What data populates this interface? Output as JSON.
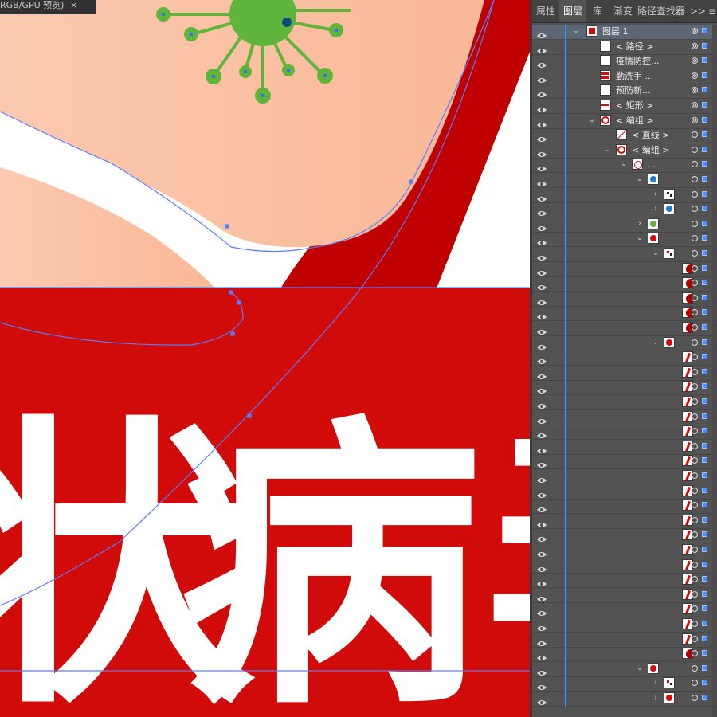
{
  "document": {
    "tab_title": "RGB/GPU 预览)",
    "close_glyph": "×"
  },
  "artwork": {
    "headline_chars": [
      "状",
      "病",
      "毒"
    ],
    "colors": {
      "banner_red": "#d10a0a",
      "ring_dark_red": "#c00000",
      "skin": "#fcc4a6",
      "virus_green": "#5fb43c",
      "white": "#ffffff",
      "path_outline": "#5b7cff"
    }
  },
  "panel": {
    "tabs": [
      "属性",
      "图层",
      "库",
      "渐变",
      "路径查找器"
    ],
    "active_tab": "图层",
    "overflow_glyph": ">>",
    "menu_glyph": "≡",
    "layers": [
      {
        "indent": 0,
        "twisty": "open",
        "thumb": "poster",
        "label": "图层 1",
        "selected": true,
        "target": "dbl"
      },
      {
        "indent": 1,
        "twisty": "none",
        "thumb": "white",
        "label": "< 路径 >",
        "target": "dbl"
      },
      {
        "indent": 1,
        "twisty": "none",
        "thumb": "white",
        "label": "疫情防控...",
        "target": "dbl"
      },
      {
        "indent": 1,
        "twisty": "none",
        "thumb": "redtext",
        "label": "勤洗手 ...",
        "target": "dbl"
      },
      {
        "indent": 1,
        "twisty": "none",
        "thumb": "white",
        "label": "预防新...",
        "target": "dbl"
      },
      {
        "indent": 1,
        "twisty": "none",
        "thumb": "redbar",
        "label": "< 矩形 >",
        "target": "dbl"
      },
      {
        "indent": 1,
        "twisty": "open",
        "thumb": "redcirc",
        "label": "< 编组 >",
        "target": "dbl"
      },
      {
        "indent": 2,
        "twisty": "none",
        "thumb": "line",
        "label": "< 直线 >",
        "target": "one"
      },
      {
        "indent": 2,
        "twisty": "open",
        "thumb": "redcirc",
        "label": "< 编组 >",
        "target": "one"
      },
      {
        "indent": 3,
        "twisty": "open",
        "thumb": "group",
        "label": "...",
        "target": "one"
      },
      {
        "indent": 4,
        "twisty": "open",
        "thumb": "bluevirus",
        "label": "",
        "target": "one"
      },
      {
        "indent": 5,
        "twisty": "closed",
        "thumb": "dots",
        "label": "",
        "target": "one"
      },
      {
        "indent": 5,
        "twisty": "closed",
        "thumb": "bluevirus",
        "label": "",
        "target": "one"
      },
      {
        "indent": 4,
        "twisty": "closed",
        "thumb": "greenvirus",
        "label": "",
        "target": "one"
      },
      {
        "indent": 4,
        "twisty": "open",
        "thumb": "redvirus",
        "label": "",
        "target": "one"
      },
      {
        "indent": 5,
        "twisty": "open",
        "thumb": "reddots",
        "label": "",
        "target": "one"
      },
      {
        "indent": 6,
        "twisty": "none",
        "thumb": "halfcirc",
        "label": "",
        "target": "one"
      },
      {
        "indent": 6,
        "twisty": "none",
        "thumb": "halfcirc",
        "label": "",
        "target": "one"
      },
      {
        "indent": 6,
        "twisty": "none",
        "thumb": "halfcirc",
        "label": "",
        "target": "one"
      },
      {
        "indent": 6,
        "twisty": "none",
        "thumb": "halfcirc",
        "label": "",
        "target": "one"
      },
      {
        "indent": 6,
        "twisty": "none",
        "thumb": "halfcirc",
        "label": "",
        "target": "one"
      },
      {
        "indent": 5,
        "twisty": "open",
        "thumb": "redvirus",
        "label": "",
        "target": "one"
      },
      {
        "indent": 6,
        "twisty": "none",
        "thumb": "spike",
        "label": "",
        "target": "one"
      },
      {
        "indent": 6,
        "twisty": "none",
        "thumb": "spike",
        "label": "",
        "target": "one"
      },
      {
        "indent": 6,
        "twisty": "none",
        "thumb": "spike",
        "label": "",
        "target": "one"
      },
      {
        "indent": 6,
        "twisty": "none",
        "thumb": "spike",
        "label": "",
        "target": "one"
      },
      {
        "indent": 6,
        "twisty": "none",
        "thumb": "spike",
        "label": "",
        "target": "one"
      },
      {
        "indent": 6,
        "twisty": "none",
        "thumb": "spike",
        "label": "",
        "target": "one"
      },
      {
        "indent": 6,
        "twisty": "none",
        "thumb": "spike",
        "label": "",
        "target": "one"
      },
      {
        "indent": 6,
        "twisty": "none",
        "thumb": "spike",
        "label": "",
        "target": "one"
      },
      {
        "indent": 6,
        "twisty": "none",
        "thumb": "spike",
        "label": "",
        "target": "one"
      },
      {
        "indent": 6,
        "twisty": "none",
        "thumb": "spike",
        "label": "",
        "target": "one"
      },
      {
        "indent": 6,
        "twisty": "none",
        "thumb": "spike",
        "label": "",
        "target": "one"
      },
      {
        "indent": 6,
        "twisty": "none",
        "thumb": "spike",
        "label": "",
        "target": "one"
      },
      {
        "indent": 6,
        "twisty": "none",
        "thumb": "spike",
        "label": "",
        "target": "one"
      },
      {
        "indent": 6,
        "twisty": "none",
        "thumb": "spike",
        "label": "",
        "target": "one"
      },
      {
        "indent": 6,
        "twisty": "none",
        "thumb": "spike",
        "label": "",
        "target": "one"
      },
      {
        "indent": 6,
        "twisty": "none",
        "thumb": "spike",
        "label": "",
        "target": "one"
      },
      {
        "indent": 6,
        "twisty": "none",
        "thumb": "spike",
        "label": "",
        "target": "one"
      },
      {
        "indent": 6,
        "twisty": "none",
        "thumb": "spike",
        "label": "",
        "target": "one"
      },
      {
        "indent": 6,
        "twisty": "none",
        "thumb": "spike",
        "label": "",
        "target": "one"
      },
      {
        "indent": 6,
        "twisty": "none",
        "thumb": "spike",
        "label": "",
        "target": "one"
      },
      {
        "indent": 6,
        "twisty": "none",
        "thumb": "halfcirc",
        "label": "",
        "target": "one"
      },
      {
        "indent": 4,
        "twisty": "open",
        "thumb": "redvirus",
        "label": "",
        "target": "one"
      },
      {
        "indent": 5,
        "twisty": "closed",
        "thumb": "reddots",
        "label": "",
        "target": "one"
      },
      {
        "indent": 5,
        "twisty": "closed",
        "thumb": "redvirus",
        "label": "",
        "target": "one"
      }
    ]
  }
}
